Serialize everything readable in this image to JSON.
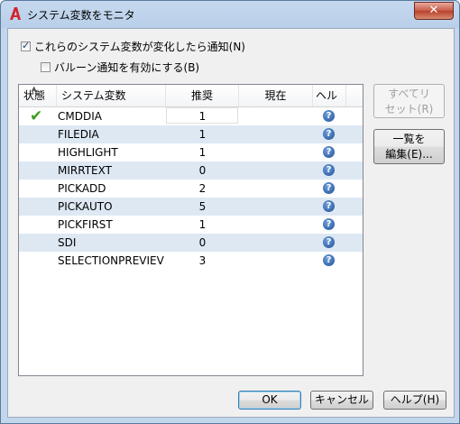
{
  "window": {
    "title": "システム変数をモニタ",
    "close_label": "✕"
  },
  "options": {
    "notify_label": "これらのシステム変数が変化したら通知(N)",
    "notify_checked": true,
    "balloon_label": "バルーン通知を有効にする(B)",
    "balloon_checked": false
  },
  "table": {
    "columns": [
      "状態",
      "システム変数",
      "推奨",
      "現在",
      "ヘル"
    ],
    "rows": [
      {
        "status": "ok",
        "name": "CMDDIA",
        "preferred": "1",
        "current": "",
        "help": "?"
      },
      {
        "status": "",
        "name": "FILEDIA",
        "preferred": "1",
        "current": "",
        "help": "?"
      },
      {
        "status": "",
        "name": "HIGHLIGHT",
        "preferred": "1",
        "current": "",
        "help": "?"
      },
      {
        "status": "",
        "name": "MIRRTEXT",
        "preferred": "0",
        "current": "",
        "help": "?"
      },
      {
        "status": "",
        "name": "PICKADD",
        "preferred": "2",
        "current": "",
        "help": "?"
      },
      {
        "status": "",
        "name": "PICKAUTO",
        "preferred": "5",
        "current": "",
        "help": "?"
      },
      {
        "status": "",
        "name": "PICKFIRST",
        "preferred": "1",
        "current": "",
        "help": "?"
      },
      {
        "status": "",
        "name": "SDI",
        "preferred": "0",
        "current": "",
        "help": "?"
      },
      {
        "status": "",
        "name": "SELECTIONPREVIEV",
        "preferred": "3",
        "current": "",
        "help": "?"
      }
    ]
  },
  "side_buttons": {
    "reset_all_line1": "すべてリ",
    "reset_all_line2": "セット(R)",
    "edit_list_line1": "一覧を",
    "edit_list_line2": "編集(E)..."
  },
  "footer": {
    "ok_label": "OK",
    "cancel_label": "キャンセル",
    "help_label": "ヘルプ(H)"
  },
  "colors": {
    "alt_row": "#dde8f3",
    "status_ok": "#3d9b1e",
    "help_icon": "#1f4f95"
  }
}
